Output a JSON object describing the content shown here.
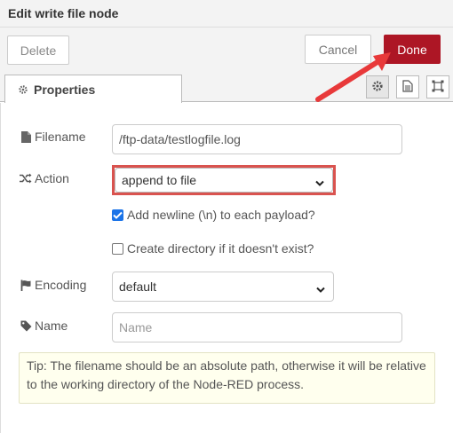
{
  "tray": {
    "title": "Edit write file node"
  },
  "toolbar": {
    "delete_label": "Delete",
    "cancel_label": "Cancel",
    "done_label": "Done"
  },
  "tabs": {
    "properties_label": "Properties",
    "icons": [
      "gear-icon",
      "document-icon",
      "frame-icon"
    ]
  },
  "form": {
    "filename_label": "Filename",
    "filename_value": "/ftp-data/testlogfile.log",
    "action_label": "Action",
    "action_value": "append to file",
    "add_newline_label": "Add newline (\\n) to each payload?",
    "add_newline_checked": true,
    "create_dir_label": "Create directory if it doesn't exist?",
    "create_dir_checked": false,
    "encoding_label": "Encoding",
    "encoding_value": "default",
    "name_label": "Name",
    "name_placeholder": "Name"
  },
  "tip": {
    "text": "Tip: The filename should be an absolute path, otherwise it will be relative to the working directory of the Node-RED process."
  },
  "colors": {
    "done_bg": "#ad1625",
    "highlight": "#d9534f",
    "arrow": "#e8393a",
    "tip_bg": "#ffffee"
  }
}
